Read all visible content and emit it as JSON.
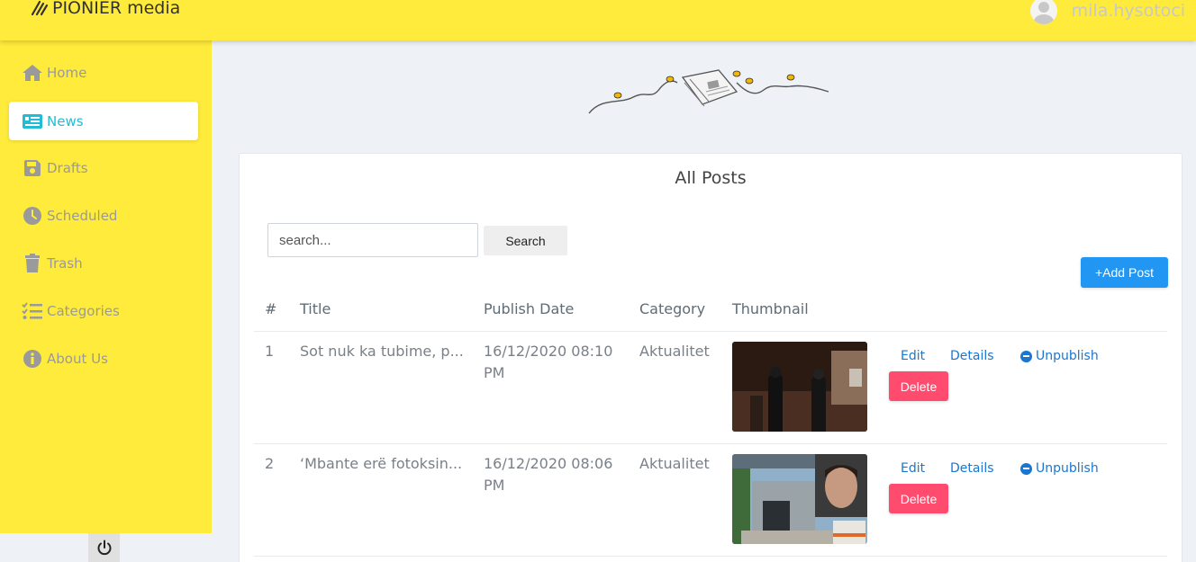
{
  "brand": {
    "name": "PIONIER media"
  },
  "user": {
    "username": "mila.hysotoci"
  },
  "sidebar": {
    "items": [
      {
        "label": "Home",
        "icon": "home-icon"
      },
      {
        "label": "News",
        "icon": "newspaper-icon",
        "active": true
      },
      {
        "label": "Drafts",
        "icon": "save-icon"
      },
      {
        "label": "Scheduled",
        "icon": "clock-icon"
      },
      {
        "label": "Trash",
        "icon": "trash-icon"
      },
      {
        "label": "Categories",
        "icon": "list-check-icon"
      },
      {
        "label": "About Us",
        "icon": "info-icon"
      }
    ],
    "logout_icon": "power-icon"
  },
  "main": {
    "title": "All Posts",
    "search": {
      "placeholder": "search...",
      "value": "",
      "button_label": "Search"
    },
    "add_button_label": "+Add Post",
    "table": {
      "headers": [
        "#",
        "Title",
        "Publish Date",
        "Category",
        "Thumbnail"
      ],
      "rows": [
        {
          "num": "1",
          "title": "Sot nuk ka tubime, p...",
          "date_line1": "16/12/2020 08:10",
          "date_line2": "PM",
          "category": "Aktualitet",
          "edit": "Edit",
          "details": "Details",
          "unpublish": "Unpublish",
          "delete": "Delete"
        },
        {
          "num": "2",
          "title": "‘Mbante erë fotoksin...",
          "date_line1": "16/12/2020 08:06",
          "date_line2": "PM",
          "category": "Aktualitet",
          "edit": "Edit",
          "details": "Details",
          "unpublish": "Unpublish",
          "delete": "Delete"
        }
      ]
    }
  },
  "colors": {
    "topbar": "#ffeb3b",
    "active": "#22bcd6",
    "primary": "#2196f3",
    "danger": "#ff4b6e",
    "link": "#1976d2"
  }
}
